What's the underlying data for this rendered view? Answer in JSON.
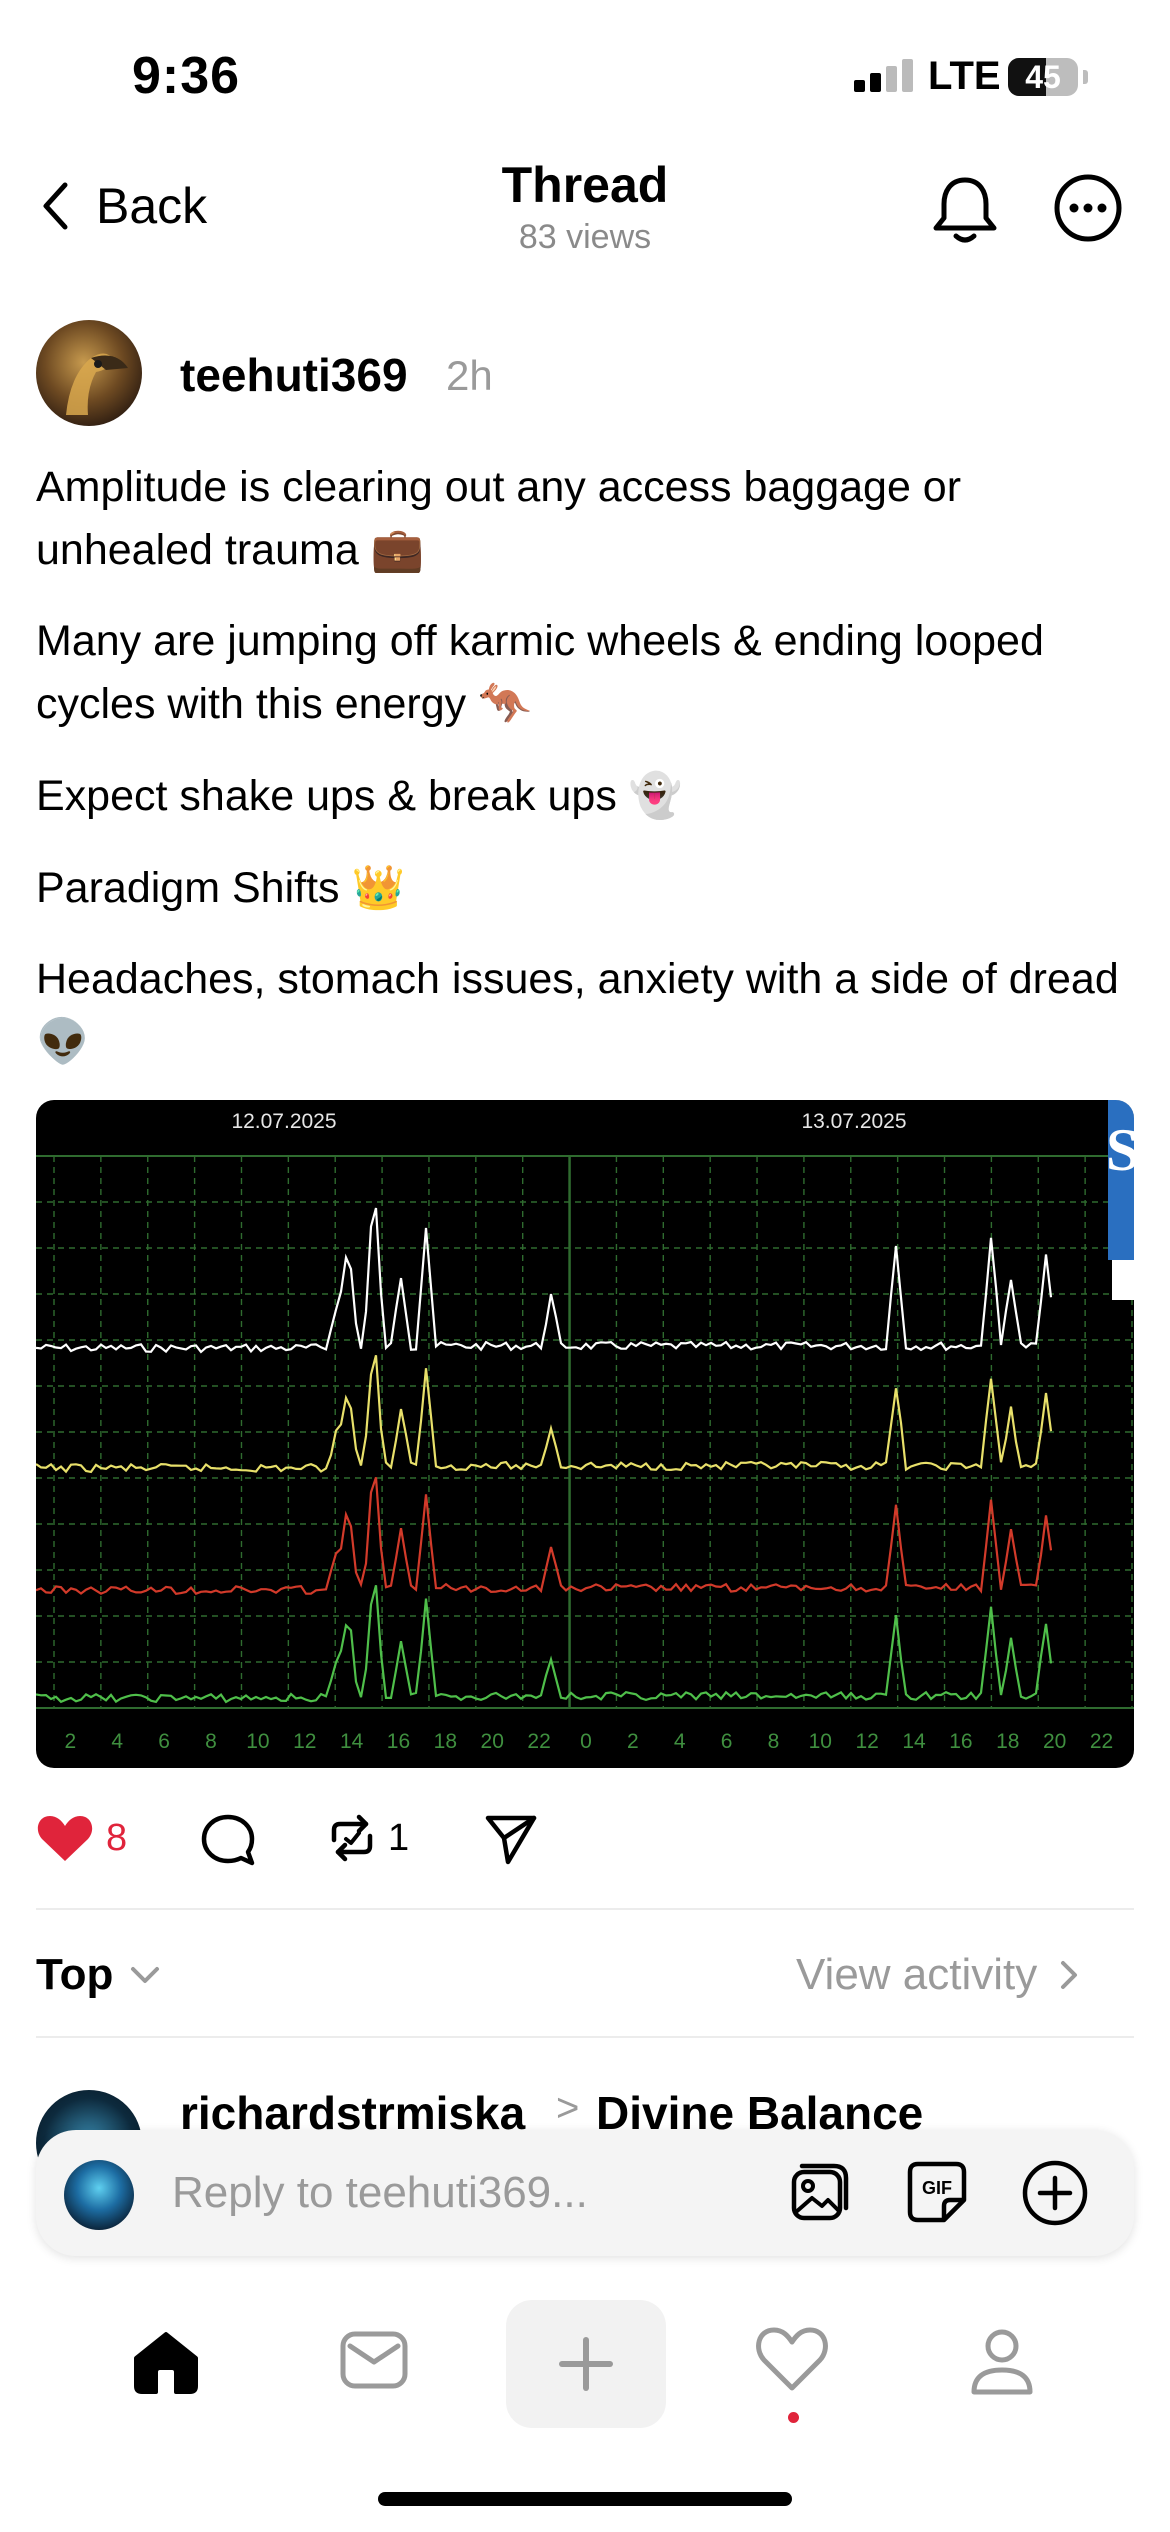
{
  "status_bar": {
    "time": "9:36",
    "network": "LTE",
    "battery": "45"
  },
  "header": {
    "back_label": "Back",
    "title": "Thread",
    "views": "83 views"
  },
  "post": {
    "username": "teehuti369",
    "time": "2h",
    "paragraphs": [
      {
        "text": "Amplitude is clearing out any access baggage or unhealed trauma",
        "emoji": "💼"
      },
      {
        "text": "Many are jumping off karmic wheels & ending looped cycles with this energy",
        "emoji": "🦘"
      },
      {
        "text": "Expect shake ups & break ups",
        "emoji": "👻"
      },
      {
        "text": "Paradigm Shifts",
        "emoji": "👑"
      },
      {
        "text": "Headaches, stomach issues, anxiety with a side of dread",
        "emoji": "👽"
      }
    ],
    "image": {
      "dates": [
        "12.07.2025",
        "13.07.2025"
      ],
      "hour_ticks": [
        "2",
        "4",
        "6",
        "8",
        "10",
        "12",
        "14",
        "16",
        "18",
        "20",
        "22",
        "0",
        "2",
        "4",
        "6",
        "8",
        "10",
        "12",
        "14",
        "16",
        "18",
        "20",
        "22"
      ],
      "corner_text": "S",
      "series_colors": [
        "#ffffff",
        "#e8e06a",
        "#d23a2a",
        "#4fbf4a"
      ],
      "grid_color": "#2f6b2f"
    },
    "likes": "8",
    "reposts": "1"
  },
  "sort": {
    "label": "Top",
    "view_activity": "View activity"
  },
  "reply_preview": {
    "username": "richardstrmiska",
    "separator": ">",
    "community": "Divine Balance"
  },
  "composer": {
    "placeholder": "Reply to teehuti369..."
  },
  "colors": {
    "accent_red": "#e0243b",
    "muted_text": "#9a9a9a"
  }
}
